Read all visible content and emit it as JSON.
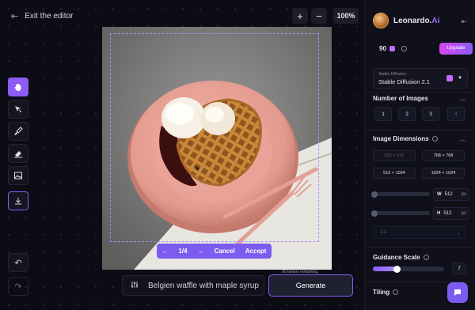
{
  "topbar": {
    "exit_label": "Exit the editor",
    "zoom_in": "+",
    "zoom_out": "−",
    "zoom_level": "100%"
  },
  "tools": [
    "hand-icon",
    "select-icon",
    "brush-icon",
    "eraser-icon",
    "image-icon",
    "download-icon"
  ],
  "pager": {
    "prev": "←",
    "page": "1/4",
    "next": "→",
    "cancel": "Cancel",
    "accept": "Accept"
  },
  "tokens_text": "90 tokens remaining.",
  "prompt": {
    "text": "Belgien waffle with maple syrup",
    "generate": "Generate"
  },
  "panel": {
    "brand_name": "Leonardo.",
    "brand_ai": "Ai",
    "credits": "90",
    "upgrade": "Upgrade",
    "model_label": "Stable Diffusion",
    "model_value": "Stable Diffusion 2.1",
    "num_images_title": "Number of Images",
    "num_images": [
      "1",
      "2",
      "3",
      "4"
    ],
    "dims_title": "Image Dimensions",
    "dims": [
      "512 × 512",
      "768 × 768",
      "512 × 1024",
      "1024 × 1024"
    ],
    "w_label": "W",
    "w_value": "512",
    "h_label": "H",
    "h_value": "512",
    "unit": "px",
    "ratio": "1:1",
    "guidance_title": "Guidance Scale",
    "guidance_value": "7",
    "tiling_title": "Tiling"
  },
  "colors": {
    "accent": "#8b5cf6",
    "bg": "#0b0c14",
    "panel": "#0f1019"
  }
}
